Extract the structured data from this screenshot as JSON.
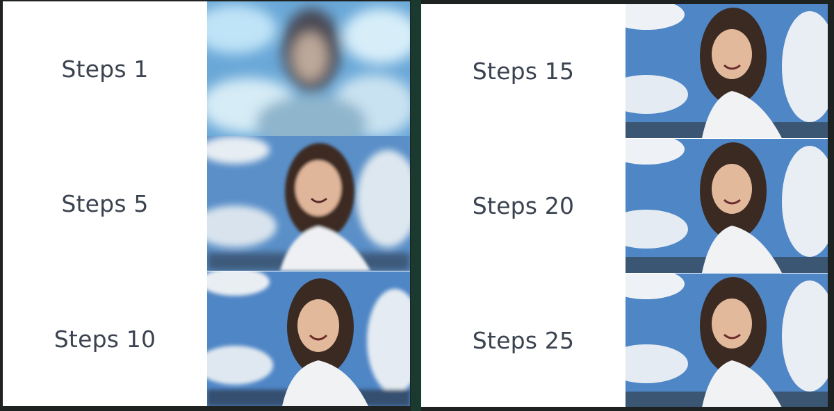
{
  "panels": {
    "left": {
      "rows": [
        {
          "label": "Steps 1"
        },
        {
          "label": "Steps 5"
        },
        {
          "label": "Steps 10"
        }
      ]
    },
    "right": {
      "rows": [
        {
          "label": "Steps 15"
        },
        {
          "label": "Steps 20"
        },
        {
          "label": "Steps 25"
        }
      ]
    }
  },
  "colors": {
    "label_text": "#3b4350",
    "background": "#1e2220",
    "divider": "#1a3a30",
    "sky": "#4f86c6",
    "cloud": "#e9eef3",
    "shirt": "#f1f2f4",
    "hair": "#3a2a22",
    "skin": "#e3b99c"
  }
}
